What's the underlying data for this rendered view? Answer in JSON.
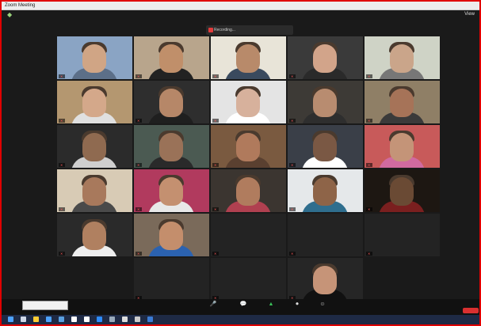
{
  "window": {
    "title": "Zoom Meeting"
  },
  "recording_banner": {
    "text": "Recording...",
    "link": ""
  },
  "top_right": {
    "label": "View"
  },
  "participants": [
    {
      "name": "",
      "kind": "video",
      "bg": "#8aa4c4",
      "skin": "#d0a585",
      "shirt": "#5c6f88"
    },
    {
      "name": "",
      "kind": "video",
      "bg": "#b8a58c",
      "skin": "#c08f6a",
      "shirt": "#222222"
    },
    {
      "name": "",
      "kind": "video",
      "bg": "#e8e4d8",
      "skin": "#b88a6a",
      "shirt": "#3a4a5e",
      "active": true
    },
    {
      "name": "",
      "kind": "video",
      "bg": "#3a3a3a",
      "skin": "#d2a48a",
      "shirt": "#2a2a2a"
    },
    {
      "name": "",
      "kind": "video",
      "bg": "#cfd3c6",
      "skin": "#caa58a",
      "shirt": "#777777"
    },
    {
      "name": "",
      "kind": "video",
      "bg": "#b49770",
      "skin": "#d4a88a",
      "shirt": "#e0e0e0"
    },
    {
      "name": "",
      "kind": "video",
      "bg": "#2e2e2e",
      "skin": "#b68768",
      "shirt": "#1f1f1f"
    },
    {
      "name": "",
      "kind": "video",
      "bg": "#e4e4e4",
      "skin": "#d7b19c",
      "shirt": "#ffffff"
    },
    {
      "name": "",
      "kind": "video",
      "bg": "#3d3a36",
      "skin": "#b88c70",
      "shirt": "#2e2e2e"
    },
    {
      "name": "",
      "kind": "video",
      "bg": "#8f7f66",
      "skin": "#a67358",
      "shirt": "#3a3a3a"
    },
    {
      "name": "",
      "kind": "video",
      "bg": "#2b2b2b",
      "skin": "#8f6a50",
      "shirt": "#cfcfcf"
    },
    {
      "name": "",
      "kind": "video",
      "bg": "#4b5a52",
      "skin": "#9a7258",
      "shirt": "#2a2a2a"
    },
    {
      "name": "",
      "kind": "video",
      "bg": "#7a5a40",
      "skin": "#b07a5c",
      "shirt": "#5a4030"
    },
    {
      "name": "",
      "kind": "video",
      "bg": "#3a3f48",
      "skin": "#7a5844",
      "shirt": "#ffffff"
    },
    {
      "name": "",
      "kind": "video",
      "bg": "#c85a5a",
      "skin": "#c49478",
      "shirt": "#d06aa0"
    },
    {
      "name": "",
      "kind": "video",
      "bg": "#d8cbb5",
      "skin": "#a8795c",
      "shirt": "#4a4a4a"
    },
    {
      "name": "",
      "kind": "video",
      "bg": "#b13a5e",
      "skin": "#c49070",
      "shirt": "#e8e8e8"
    },
    {
      "name": "",
      "kind": "video",
      "bg": "#3b3530",
      "skin": "#b07c5e",
      "shirt": "#b04050"
    },
    {
      "name": "",
      "kind": "video",
      "bg": "#e5e8ea",
      "skin": "#8e6448",
      "shirt": "#2f6e8e"
    },
    {
      "name": "",
      "kind": "video",
      "bg": "#1d1712",
      "skin": "#6a4a34",
      "shirt": "#7a1f1f"
    },
    {
      "name": "",
      "kind": "video",
      "bg": "#2a2a2a",
      "skin": "#b08060",
      "shirt": "#eeeeee"
    },
    {
      "name": "",
      "kind": "video",
      "bg": "#7a6a5a",
      "skin": "#c48e6c",
      "shirt": "#2b62b0"
    },
    {
      "name": "",
      "kind": "text",
      "center": ""
    },
    {
      "name": "",
      "kind": "text",
      "center": ""
    },
    {
      "name": "",
      "kind": "text",
      "center": ""
    },
    {
      "name": "",
      "kind": "text",
      "center": ""
    },
    {
      "name": "",
      "kind": "text",
      "center": ""
    },
    {
      "name": "",
      "kind": "video",
      "bg": "#262626",
      "skin": "#c69478",
      "shirt": "#111111"
    }
  ],
  "controls": [
    {
      "label": "",
      "icon": "mic-icon",
      "glyph": "🎤"
    },
    {
      "label": "",
      "icon": "chat-icon",
      "glyph": "💬"
    },
    {
      "label": "",
      "icon": "share-screen-icon",
      "glyph": "▲",
      "color": "#3ac25a"
    },
    {
      "label": "",
      "icon": "record-icon",
      "glyph": "⏺"
    },
    {
      "label": "",
      "icon": "reactions-icon",
      "glyph": "☺"
    }
  ],
  "chat_popup": {
    "line1": "",
    "line2": ""
  },
  "leave_button": {
    "label": ""
  },
  "colors": {
    "frame_border": "#e00000",
    "active_speaker": "#e8e25a",
    "leave": "#d93030",
    "taskbar": "#1e2a45"
  }
}
